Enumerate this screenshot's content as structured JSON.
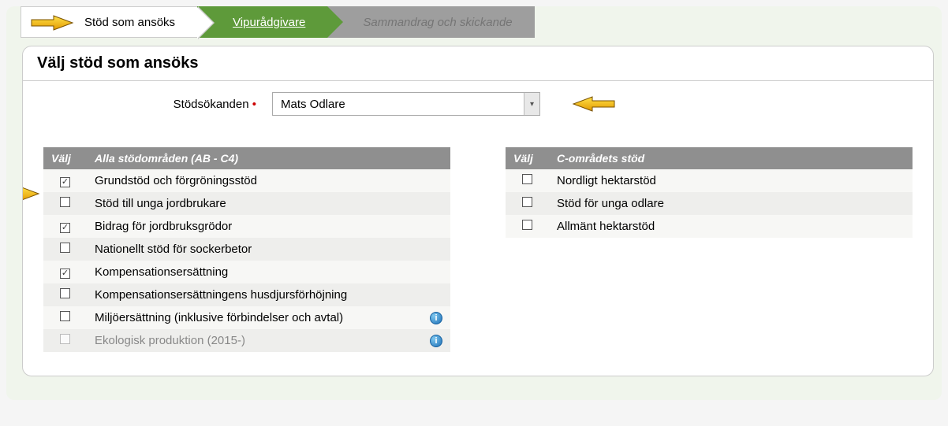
{
  "steps": {
    "s1": "Stöd som ansöks",
    "s2": "Vipurådgivare",
    "s3": "Sammandrag och skickande"
  },
  "card": {
    "title": "Välj stöd som ansöks"
  },
  "form": {
    "applicant_label": "Stödsökanden",
    "applicant_value": "Mats Odlare"
  },
  "left_table": {
    "col_valj": "Välj",
    "col_name": "Alla stödområden (AB - C4)",
    "rows": [
      {
        "label": "Grundstöd och förgröningsstöd",
        "checked": true
      },
      {
        "label": "Stöd till unga jordbrukare",
        "checked": false
      },
      {
        "label": "Bidrag för jordbruksgrödor",
        "checked": true
      },
      {
        "label": "Nationellt stöd för sockerbetor",
        "checked": false
      },
      {
        "label": "Kompensationsersättning",
        "checked": true
      },
      {
        "label": "Kompensationsersättningens husdjursförhöjning",
        "checked": false
      },
      {
        "label": "Miljöersättning (inklusive förbindelser och avtal)",
        "checked": false,
        "info": true
      },
      {
        "label": "Ekologisk produktion (2015-)",
        "checked": false,
        "info": true,
        "disabled": true
      }
    ]
  },
  "right_table": {
    "col_valj": "Välj",
    "col_name": "C-områdets stöd",
    "rows": [
      {
        "label": "Nordligt hektarstöd",
        "checked": false
      },
      {
        "label": "Stöd för unga odlare",
        "checked": false
      },
      {
        "label": "Allmänt hektarstöd",
        "checked": false
      }
    ]
  }
}
